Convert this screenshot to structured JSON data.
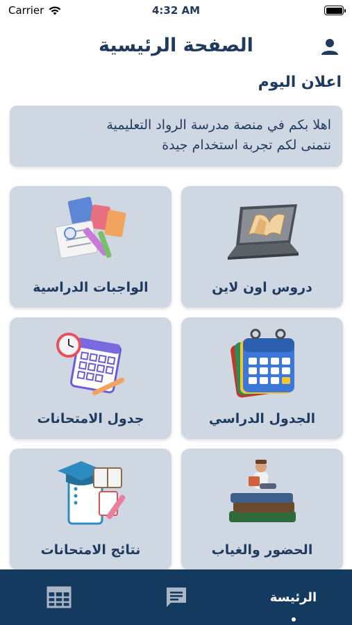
{
  "status_bar": {
    "carrier": "Carrier",
    "time": "4:32 AM"
  },
  "header": {
    "title": "الصفحة الرئيسية"
  },
  "announcement": {
    "section_title": "اعلان اليوم",
    "line1": "اهلا بكم في منصة مدرسة الرواد التعليمية",
    "line2": "نتمنى لكم تجربة استخدام جيدة"
  },
  "cards": {
    "online_lessons": "دروس اون لاين",
    "homework": "الواجبات الدراسية",
    "schedule": "الجدول الدراسي",
    "exam_schedule": "جدول الامتحانات",
    "attendance": "الحضور والغياب",
    "exam_results": "نتائج الامتحانات"
  },
  "tab_bar": {
    "home_label": "الرئيسة"
  },
  "colors": {
    "primary": "#1f3a5f",
    "card_bg": "#cfd8e2",
    "tab_bar_bg": "#153a60"
  }
}
